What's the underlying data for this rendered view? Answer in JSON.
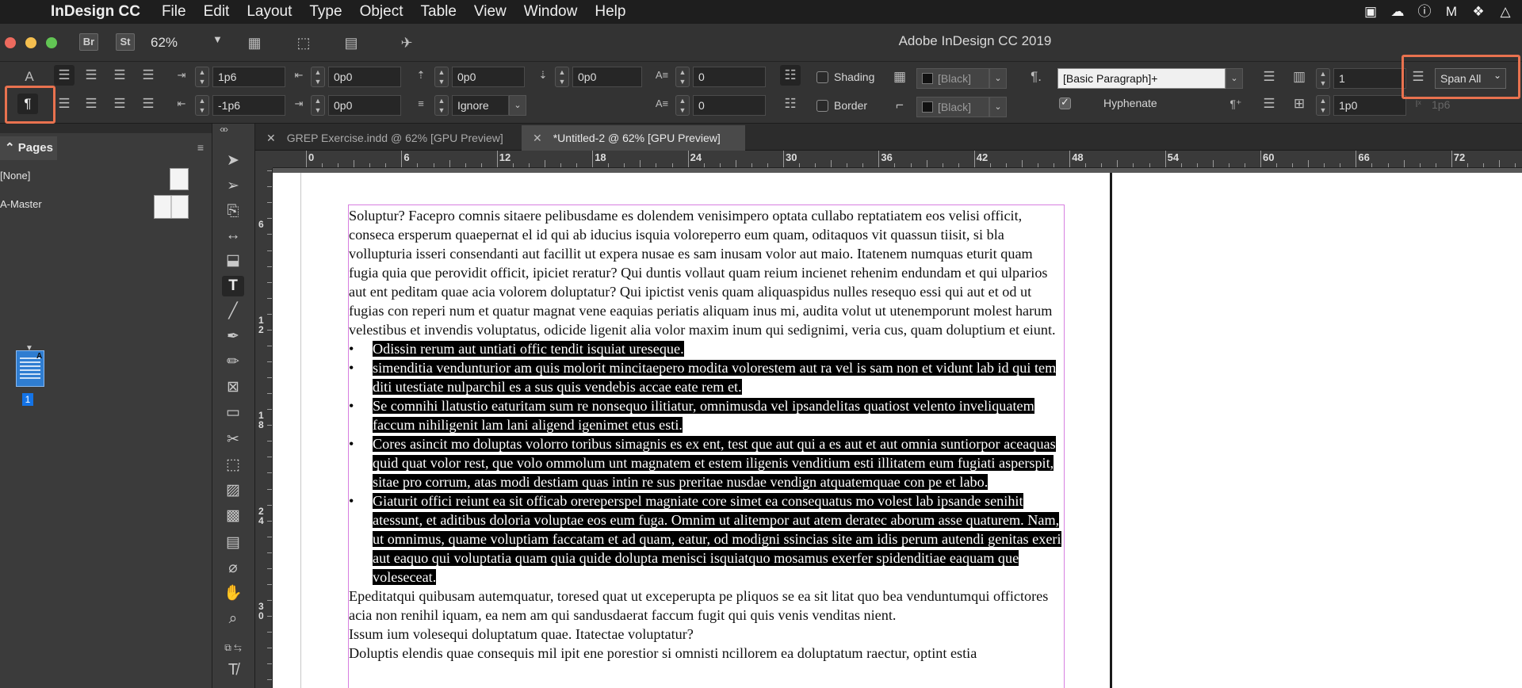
{
  "menubar": {
    "app": "InDesign CC",
    "items": [
      "File",
      "Edit",
      "Layout",
      "Type",
      "Object",
      "Table",
      "View",
      "Window",
      "Help"
    ]
  },
  "appbar": {
    "bridge": "Br",
    "stock": "St",
    "zoom": "62%",
    "title": "Adobe InDesign CC 2019"
  },
  "control": {
    "para_mode_icon": "¶",
    "char_mode_icon": "A",
    "left_indent": "1p6",
    "first_line_indent": "-1p6",
    "right_indent": "0p0",
    "last_line_indent": "0p0",
    "space_before": "0p0",
    "align_grid": "Ignore",
    "space_after": "0p0",
    "drop_cap_lines": "0",
    "drop_cap_chars": "0",
    "shading_label": "Shading",
    "border_label": "Border",
    "shading_swatch": "[Black]",
    "border_swatch": "[Black]",
    "paragraph_style": "[Basic Paragraph]+",
    "hyphenate_label": "Hyphenate",
    "columns": "1",
    "gutter": "1p0",
    "span": "Span All",
    "x_field": "1p6"
  },
  "pages_panel": {
    "tab": "Pages",
    "none_label": "[None]",
    "master_label": "A-Master",
    "page_number": "1",
    "page_master_letter": "A"
  },
  "doc_tabs": [
    {
      "label": "GREP Exercise.indd @ 62% [GPU Preview]",
      "active": false
    },
    {
      "label": "*Untitled-2 @ 62% [GPU Preview]",
      "active": true
    }
  ],
  "ruler": {
    "h_labels": [
      "0",
      "6",
      "12",
      "18",
      "24",
      "30",
      "36",
      "42",
      "48",
      "54",
      "60",
      "66",
      "72"
    ],
    "v_labels": [
      "6",
      "12",
      "18",
      "24",
      "30"
    ]
  },
  "document": {
    "para1": "Soluptur? Facepro comnis sitaere pelibusdame es dolendem venisimpero optata cullabo reptatiatem eos velisi officit, conseca ersperum quaepernat el id qui ab iducius isquia voloreperro eum quam, oditaquos vit quassun ti­isit, si bla vollupturia isseri consendanti aut facillit ut expera nusae es sam inusam volor aut maio. Itatenem num­quas eturit quam fugia quia que perovidit officit, ipiciet reratur? Qui duntis vollaut quam reium incienet rehenim endundam et qui ulparios aut ent peditam quae acia volorem doluptatur? Qui ipictist venis quam aliquaspidus nulles resequo essi qui aut et od ut fugias con reperi num et quatur magnat vene eaquias periatis aliquam inus mi, audita volut ut utenemporunt molest harum velestibus et invendis voluptatus, odicide ligenit alia volor max­im inum qui sedignimi, veria cus, quam doluptium et eiunt.",
    "bullets": [
      "Odissin rerum aut untiati offic tendit isquiat ureseque.",
      "simenditia vendunturior am quis molorit mincitaepero modita volorestem aut ra vel is sam non et vidunt lab id qui tem diti utestiate nulparchil es a sus quis vendebis accae eate rem et.",
      "Se comnihi llatustio eaturitam sum re nonsequo ilitiatur, omnimusda vel ipsandelitas quatiost velento inveli­quatem faccum nihiligenit lam lani aligend igenimet etus esti.",
      "Cores asincit mo doluptas volorro toribus simagnis es ex ent, test que aut qui a es aut et aut omnia suntiorpor aceaquas quid quat volor rest, que volo ommolum unt magnatem et estem iligenis venditium esti illitatem eum fugiati asperspit, sitae pro corrum, atas modi destiam quas intin re sus preritae nusdae vendign atqua­temquae con pe et labo.",
      "Giaturit offici reiunt ea sit officab orereperspel magniate core simet ea consequatus mo volest lab ipsande senihit atessunt, et aditibus doloria voluptae eos eum fuga. Omnim ut alitempor aut atem deratec aborum asse quaturem. Nam, ut omnimus, quame voluptiam faccatam et ad quam, eatur, od modigni ssincias site am idis perum autendi genitas exeri aut eaquo qui voluptatia quam quia quide dolupta menisci isquiatquo mosamus exerfer spidenditiae eaquam que voleseceat."
    ],
    "para2": "Epeditatqui quibusam autemquatur, toresed quat ut exceperupta pe pliquos se ea sit litat quo bea venduntumqui offictores acia non renihil iquam, ea nem am qui sandusdaerat faccum fugit qui quis venis venditas nient.",
    "para3": "Issum ium volesequi doluptatum quae. Itatectae voluptatur?",
    "para4": "Doluptis elendis quae consequis mil ipit ene porestior si omnisti ncillorem ea doluptatum raectur, optint estia"
  },
  "colors": {
    "highlight_box": "#e9724f",
    "frame_edge": "#d77fe0",
    "selection": "#000000"
  }
}
